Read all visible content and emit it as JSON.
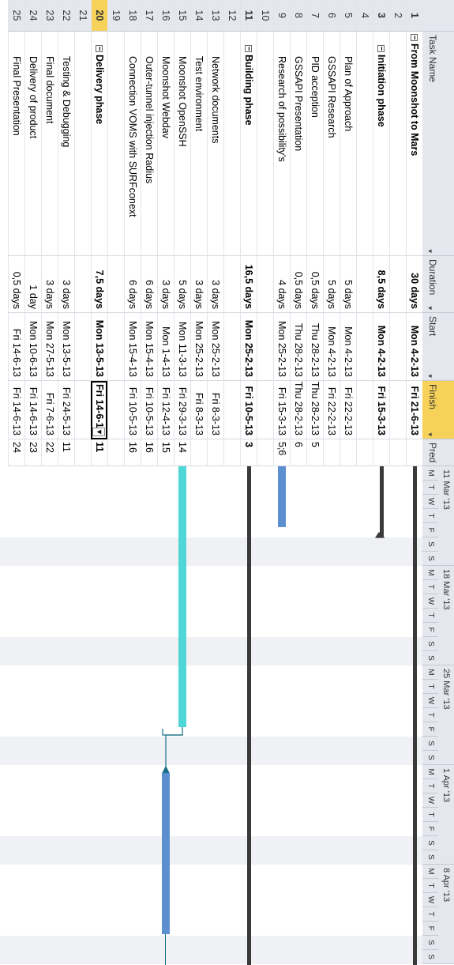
{
  "columns": {
    "task_name": "Task Name",
    "duration": "Duration",
    "start": "Start",
    "finish": "Finish",
    "predecessors": "Pred"
  },
  "rows": [
    {
      "id": "1",
      "name": "From Moonshot to Mars",
      "duration": "30 days",
      "start": "Mon 4-2-13",
      "finish": "Fri 21-6-13",
      "pred": "",
      "level": 0,
      "summary": true
    },
    {
      "id": "2",
      "name": "",
      "duration": "",
      "start": "",
      "finish": "",
      "pred": "",
      "level": 0,
      "summary": false
    },
    {
      "id": "3",
      "name": "Initiation phase",
      "duration": "8,5 days",
      "start": "Mon 4-2-13",
      "finish": "Fri 15-3-13",
      "pred": "",
      "level": 1,
      "summary": true
    },
    {
      "id": "4",
      "name": "",
      "duration": "",
      "start": "",
      "finish": "",
      "pred": "",
      "level": 0,
      "summary": false
    },
    {
      "id": "5",
      "name": "Plan of Approach",
      "duration": "5 days",
      "start": "Mon 4-2-13",
      "finish": "Fri 22-2-13",
      "pred": "",
      "level": 2,
      "summary": false
    },
    {
      "id": "6",
      "name": "GSSAPI Research",
      "duration": "5 days",
      "start": "Mon 4-2-13",
      "finish": "Fri 22-2-13",
      "pred": "",
      "level": 2,
      "summary": false
    },
    {
      "id": "7",
      "name": "PID acception",
      "duration": "0,5 days",
      "start": "Thu 28-2-13",
      "finish": "Thu 28-2-13",
      "pred": "5",
      "level": 2,
      "summary": false
    },
    {
      "id": "8",
      "name": "GSSAPI Presentation",
      "duration": "0,5 days",
      "start": "Thu 28-2-13",
      "finish": "Thu 28-2-13",
      "pred": "6",
      "level": 2,
      "summary": false
    },
    {
      "id": "9",
      "name": "Research of possibility's",
      "duration": "4 days",
      "start": "Mon 25-2-13",
      "finish": "Fri 15-3-13",
      "pred": "5;6",
      "level": 2,
      "summary": false
    },
    {
      "id": "10",
      "name": "",
      "duration": "",
      "start": "",
      "finish": "",
      "pred": "",
      "level": 0,
      "summary": false
    },
    {
      "id": "11",
      "name": "Building phase",
      "duration": "16,5 days",
      "start": "Mon 25-2-13",
      "finish": "Fri 10-5-13",
      "pred": "3",
      "level": 1,
      "summary": true
    },
    {
      "id": "12",
      "name": "",
      "duration": "",
      "start": "",
      "finish": "",
      "pred": "",
      "level": 0,
      "summary": false
    },
    {
      "id": "13",
      "name": "Network documents",
      "duration": "3 days",
      "start": "Mon 25-2-13",
      "finish": "Fri 8-3-13",
      "pred": "",
      "level": 2,
      "summary": false
    },
    {
      "id": "14",
      "name": "Test environment",
      "duration": "3 days",
      "start": "Mon 25-2-13",
      "finish": "Fri 8-3-13",
      "pred": "",
      "level": 2,
      "summary": false
    },
    {
      "id": "15",
      "name": "Moonshot OpenSSH",
      "duration": "5 days",
      "start": "Mon 11-3-13",
      "finish": "Fri 29-3-13",
      "pred": "14",
      "level": 2,
      "summary": false
    },
    {
      "id": "16",
      "name": "Moonshot Webdav",
      "duration": "3 days",
      "start": "Mon 1-4-13",
      "finish": "Fri 12-4-13",
      "pred": "15",
      "level": 2,
      "summary": false
    },
    {
      "id": "17",
      "name": "Outer-tunnel injection Radius",
      "duration": "6 days",
      "start": "Mon 15-4-13",
      "finish": "Fri 10-5-13",
      "pred": "16",
      "level": 2,
      "summary": false
    },
    {
      "id": "18",
      "name": "Connection VOMS with SURFconext",
      "duration": "6 days",
      "start": "Mon 15-4-13",
      "finish": "Fri 10-5-13",
      "pred": "16",
      "level": 2,
      "summary": false
    },
    {
      "id": "19",
      "name": "",
      "duration": "",
      "start": "",
      "finish": "",
      "pred": "",
      "level": 0,
      "summary": false
    },
    {
      "id": "20",
      "name": "Delivery phase",
      "duration": "7,5 days",
      "start": "Mon 13-5-13",
      "finish": "Fri 14-6-13",
      "pred": "11",
      "level": 1,
      "summary": true
    },
    {
      "id": "21",
      "name": "",
      "duration": "",
      "start": "",
      "finish": "",
      "pred": "",
      "level": 0,
      "summary": false
    },
    {
      "id": "22",
      "name": "Testing & Debugging",
      "duration": "3 days",
      "start": "Mon 13-5-13",
      "finish": "Fri 24-5-13",
      "pred": "11",
      "level": 2,
      "summary": false
    },
    {
      "id": "23",
      "name": "Final document",
      "duration": "3 days",
      "start": "Mon 27-5-13",
      "finish": "Fri 7-6-13",
      "pred": "22",
      "level": 2,
      "summary": false
    },
    {
      "id": "24",
      "name": "Delivery of product",
      "duration": "1 day",
      "start": "Mon 10-6-13",
      "finish": "Fri 14-6-13",
      "pred": "23",
      "level": 2,
      "summary": false
    },
    {
      "id": "25",
      "name": "Final Presentation",
      "duration": "0,5 days",
      "start": "Fri 14-6-13",
      "finish": "Fri 14-6-13",
      "pred": "24",
      "level": 2,
      "summary": false
    }
  ],
  "selected_row_id": "20",
  "selected_cell_value": "Fri 14-6-1",
  "timescale": {
    "weeks": [
      "11 Mar '13",
      "18 Mar '13",
      "25 Mar '13",
      "1 Apr '13",
      "8 Apr '13"
    ],
    "day_letters": [
      "M",
      "T",
      "W",
      "T",
      "F",
      "S",
      "S"
    ]
  },
  "colors": {
    "header_bg": "#e4e8ee",
    "selected_header": "#f7d25a",
    "selected_row_number": "#f7d25a",
    "summary_bar": "#3a3a3a",
    "task_bar": "#5b8fd0",
    "critical_bar": "#4fd6d6",
    "link_arrow": "#1b6f87"
  }
}
